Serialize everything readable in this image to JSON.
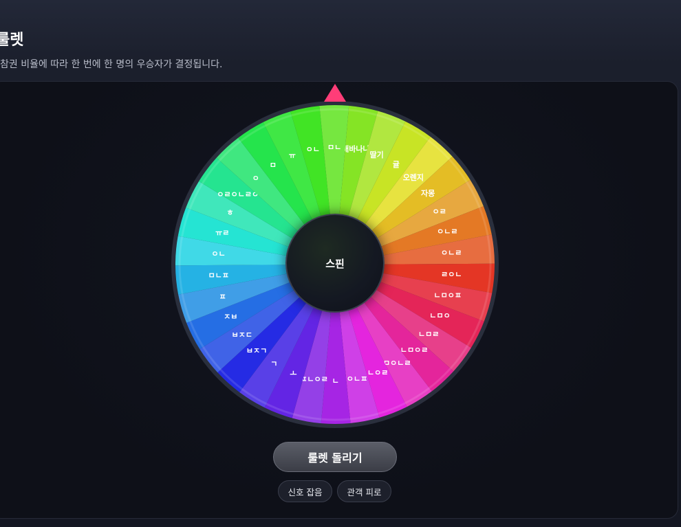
{
  "header": {
    "title": "룰렛",
    "subtitle": "참권 비율에 따라 한 번에 한 명의 우승자가 결정됩니다."
  },
  "wheel": {
    "center_label": "스핀",
    "pointer_color": "#ff3d78",
    "segments": [
      "배바나나",
      "딸기",
      "귤",
      "오렌지",
      "자몽",
      "ㅇㄹ",
      "ㅇㄴㄹ",
      "ㅇㄴㄹ",
      "ㄹㅇㄴ",
      "ㄴㅁㅇㅍ",
      "ㄴㅁㅇ",
      "ㄴㅁㄹ",
      "ㄴㅁㅇㄹ",
      "ㅁㅇㄴㄹ",
      "ㄴㅇㄹ",
      "ㅇㄴㅍ",
      "ㄴ",
      "ㅍㄴㅇㄹ",
      "ㅗ",
      "ㄱ",
      "ㅂㅈㄱ",
      "ㅂㅈㄷ",
      "ㅈㅂ",
      "ㅍ",
      "ㅁㄴㅍ",
      "ㅇㄴ",
      "ㅠㄹ",
      "ㅎ",
      "ㅇㄹㅇㄴㄹㅇㄴ",
      "ㅇ",
      "ㅁ",
      "ㅠ",
      "ㅇㄴ",
      "ㅁㄴ"
    ]
  },
  "controls": {
    "spin_button": "룰렛 돌리기",
    "chips": [
      "신호 잡음",
      "관객 피로"
    ]
  }
}
